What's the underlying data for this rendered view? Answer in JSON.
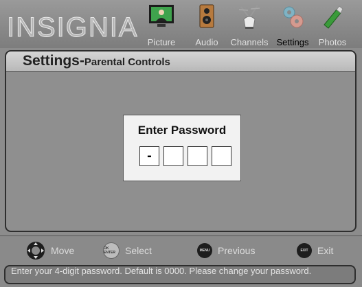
{
  "header": {
    "brand": "INSIGNIA",
    "tabs": [
      {
        "label": "Picture",
        "icon": "tv-icon"
      },
      {
        "label": "Audio",
        "icon": "speaker-icon"
      },
      {
        "label": "Channels",
        "icon": "antenna-icon"
      },
      {
        "label": "Settings",
        "icon": "gears-icon",
        "active": true
      },
      {
        "label": "Photos",
        "icon": "usb-stick-icon"
      }
    ]
  },
  "panel": {
    "title_main": "Settings-",
    "title_sub": "Parental Controls"
  },
  "dialog": {
    "title": "Enter Password",
    "digits": [
      "-",
      "",
      "",
      ""
    ]
  },
  "footer": {
    "move_label": "Move",
    "select_label": "Select",
    "select_button": "OK ENTER",
    "previous_label": "Previous",
    "previous_button": "MENU",
    "exit_label": "Exit",
    "exit_button": "EXIT",
    "message": "Enter your 4-digit password. Default is 0000. Please change your password."
  },
  "colors": {
    "background": "#8c8c8c",
    "dialog": "#f2f2f2",
    "active_tab_text": "#000000"
  }
}
